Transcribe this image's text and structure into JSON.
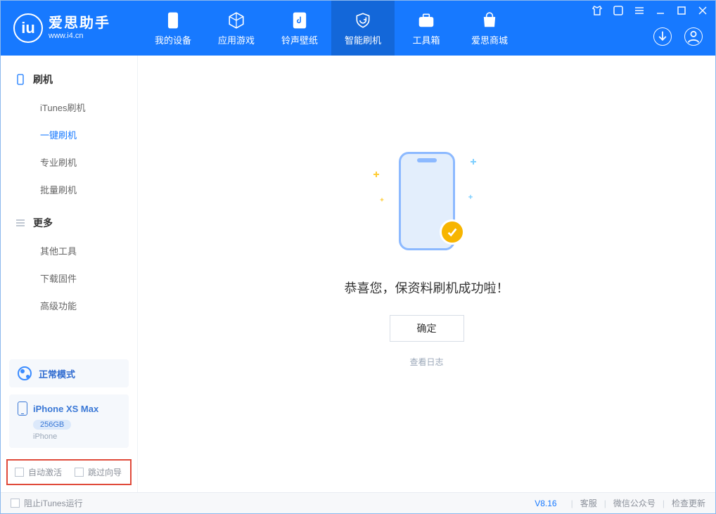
{
  "app": {
    "title": "爱思助手",
    "subtitle": "www.i4.cn"
  },
  "nav": {
    "device": "我的设备",
    "apps": "应用游戏",
    "ring": "铃声壁纸",
    "flash": "智能刷机",
    "toolbox": "工具箱",
    "store": "爱思商城"
  },
  "sidebar": {
    "group1_title": "刷机",
    "items1": {
      "itunes": "iTunes刷机",
      "onekey": "一键刷机",
      "pro": "专业刷机",
      "batch": "批量刷机"
    },
    "group2_title": "更多",
    "items2": {
      "other": "其他工具",
      "firmware": "下载固件",
      "advanced": "高级功能"
    }
  },
  "device": {
    "mode": "正常模式",
    "name": "iPhone XS Max",
    "storage": "256GB",
    "type": "iPhone"
  },
  "checks": {
    "auto_activate": "自动激活",
    "skip_guide": "跳过向导"
  },
  "main": {
    "message": "恭喜您，保资料刷机成功啦！",
    "ok": "确定",
    "view_log": "查看日志"
  },
  "footer": {
    "block_itunes": "阻止iTunes运行",
    "version": "V8.16",
    "support": "客服",
    "wechat": "微信公众号",
    "update": "检查更新"
  }
}
